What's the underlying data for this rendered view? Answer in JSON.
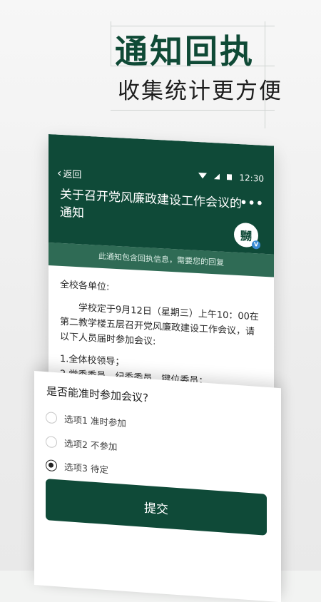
{
  "promo": {
    "title": "通知回执",
    "subtitle": "收集统计更方便"
  },
  "status_bar": {
    "time": "12:30"
  },
  "header": {
    "back_label": "返回",
    "notice_title": "关于召开党风廉政建设工作会议的通知",
    "avatar_text": "嬲",
    "verified_badge": "V"
  },
  "banner": {
    "text": "此通知包含回执信息，需要您的回复"
  },
  "notice_body": {
    "greeting": "全校各单位:",
    "paragraph": "学校定于9月12日（星期三）上午10：00在第二教学楼五层召开党风廉政建设工作会议，请以下人员届时参加会议:",
    "items": [
      "1.全体校领导；",
      "2.党委委员、纪委委员、键位委员；"
    ]
  },
  "form": {
    "question": "是否能准时参加会议?",
    "options": [
      {
        "label": "选项1 准时参加",
        "selected": false
      },
      {
        "label": "选项2 不参加",
        "selected": false
      },
      {
        "label": "选项3 待定",
        "selected": true
      }
    ],
    "submit_label": "提交"
  },
  "colors": {
    "brand": "#0f4a38",
    "banner": "#2f6b55"
  }
}
